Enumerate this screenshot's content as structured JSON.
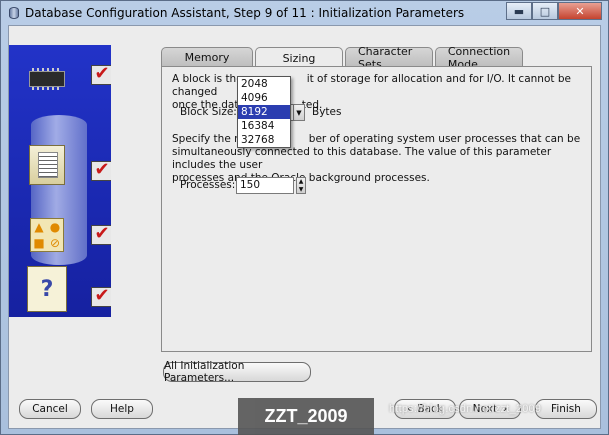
{
  "window": {
    "title": "Database Configuration Assistant, Step 9 of 11 : Initialization Parameters",
    "minimize": "▬",
    "maximize": "□",
    "close": "✕"
  },
  "tabs": [
    {
      "label": "Memory",
      "active": false
    },
    {
      "label": "Sizing",
      "active": true
    },
    {
      "label": "Character Sets",
      "active": false
    },
    {
      "label": "Connection Mode",
      "active": false
    }
  ],
  "sizing": {
    "block_text_left": "A block is the",
    "block_text_right": "it of storage for allocation and for I/O. It cannot be changed",
    "block_text_line2_left": "once the datal",
    "block_text_line2_right": "ted.",
    "block_size_label": "Block Size:",
    "block_size_unit": "Bytes",
    "block_size_options": [
      "2048",
      "4096",
      "8192",
      "16384",
      "32768"
    ],
    "block_size_selected": "8192",
    "processes_text_l1a": "Specify the ma",
    "processes_text_l1b": "ber of operating system user processes that can be",
    "processes_text_l2": "simultaneously connected to this database. The value of this parameter includes the user",
    "processes_text_l3": "processes and the Oracle background processes.",
    "processes_label": "Processes:",
    "processes_value": "150"
  },
  "buttons": {
    "all_params": "All Initialization Parameters...",
    "cancel": "Cancel",
    "help": "Help",
    "back": "Back",
    "next": "Next",
    "finish": "Finish"
  },
  "overlay": {
    "watermark": "ZZT_2009",
    "url": "https://blog.csdn.net/zzt_2009"
  },
  "icons": [
    "app-db-icon",
    "chip-icon",
    "folder-icon",
    "shapes-icon",
    "documents-icon",
    "checkmark-icon"
  ]
}
